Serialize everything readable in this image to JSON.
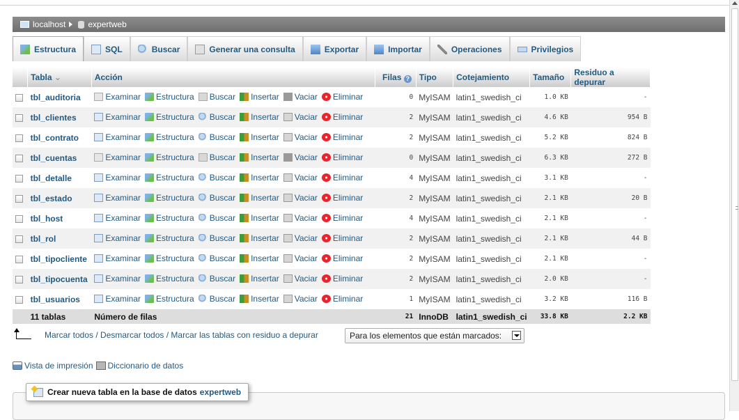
{
  "breadcrumb": {
    "server": "localhost",
    "database": "expertweb"
  },
  "tabs": [
    {
      "label": "Estructura",
      "icon": "structure-icon",
      "active": true
    },
    {
      "label": "SQL",
      "icon": "sql-icon",
      "active": false
    },
    {
      "label": "Buscar",
      "icon": "search-icon",
      "active": false
    },
    {
      "label": "Generar una consulta",
      "icon": "query-icon",
      "active": false
    },
    {
      "label": "Exportar",
      "icon": "export-icon",
      "active": false
    },
    {
      "label": "Importar",
      "icon": "import-icon",
      "active": false
    },
    {
      "label": "Operaciones",
      "icon": "wrench-icon",
      "active": false
    },
    {
      "label": "Privilegios",
      "icon": "privileges-icon",
      "active": false
    }
  ],
  "table": {
    "headers": {
      "tabla": "Tabla",
      "accion": "Acción",
      "filas": "Filas",
      "tipo": "Tipo",
      "cotejamiento": "Cotejamiento",
      "tamano": "Tamaño",
      "residuo": "Residuo a depurar"
    },
    "actions": {
      "examinar": "Examinar",
      "estructura": "Estructura",
      "buscar": "Buscar",
      "insertar": "Insertar",
      "vaciar": "Vaciar",
      "eliminar": "Eliminar"
    },
    "rows": [
      {
        "name": "tbl_auditoria",
        "rows": "0",
        "type": "MyISAM",
        "collation": "latin1_swedish_ci",
        "size": "1.0 KB",
        "overhead": "-",
        "empty": true
      },
      {
        "name": "tbl_clientes",
        "rows": "2",
        "type": "MyISAM",
        "collation": "latin1_swedish_ci",
        "size": "4.6 KB",
        "overhead": "954 B",
        "empty": false
      },
      {
        "name": "tbl_contrato",
        "rows": "2",
        "type": "MyISAM",
        "collation": "latin1_swedish_ci",
        "size": "5.2 KB",
        "overhead": "824 B",
        "empty": false
      },
      {
        "name": "tbl_cuentas",
        "rows": "0",
        "type": "MyISAM",
        "collation": "latin1_swedish_ci",
        "size": "6.3 KB",
        "overhead": "272 B",
        "empty": true
      },
      {
        "name": "tbl_detalle",
        "rows": "4",
        "type": "MyISAM",
        "collation": "latin1_swedish_ci",
        "size": "3.1 KB",
        "overhead": "-",
        "empty": false
      },
      {
        "name": "tbl_estado",
        "rows": "2",
        "type": "MyISAM",
        "collation": "latin1_swedish_ci",
        "size": "2.1 KB",
        "overhead": "20 B",
        "empty": false
      },
      {
        "name": "tbl_host",
        "rows": "4",
        "type": "MyISAM",
        "collation": "latin1_swedish_ci",
        "size": "2.1 KB",
        "overhead": "-",
        "empty": false
      },
      {
        "name": "tbl_rol",
        "rows": "2",
        "type": "MyISAM",
        "collation": "latin1_swedish_ci",
        "size": "2.1 KB",
        "overhead": "44 B",
        "empty": false
      },
      {
        "name": "tbl_tipocliente",
        "rows": "2",
        "type": "MyISAM",
        "collation": "latin1_swedish_ci",
        "size": "2.1 KB",
        "overhead": "-",
        "empty": false
      },
      {
        "name": "tbl_tipocuenta",
        "rows": "2",
        "type": "MyISAM",
        "collation": "latin1_swedish_ci",
        "size": "2.0 KB",
        "overhead": "-",
        "empty": false
      },
      {
        "name": "tbl_usuarios",
        "rows": "1",
        "type": "MyISAM",
        "collation": "latin1_swedish_ci",
        "size": "3.2 KB",
        "overhead": "116 B",
        "empty": false
      }
    ],
    "footer": {
      "count": "11 tablas",
      "label": "Número de filas",
      "rows": "21",
      "type": "InnoDB",
      "collation": "latin1_swedish_ci",
      "size": "33.8 KB",
      "overhead": "2.2 KB"
    }
  },
  "bulk": {
    "links": "Marcar todos / Desmarcar todos / Marcar las tablas con residuo a depurar",
    "select_value": "Para los elementos que están marcados:"
  },
  "print_links": {
    "print": "Vista de impresión",
    "dictionary": "Diccionario de datos"
  },
  "create_table": {
    "label": "Crear nueva tabla en la base de datos",
    "database": "expertweb"
  }
}
